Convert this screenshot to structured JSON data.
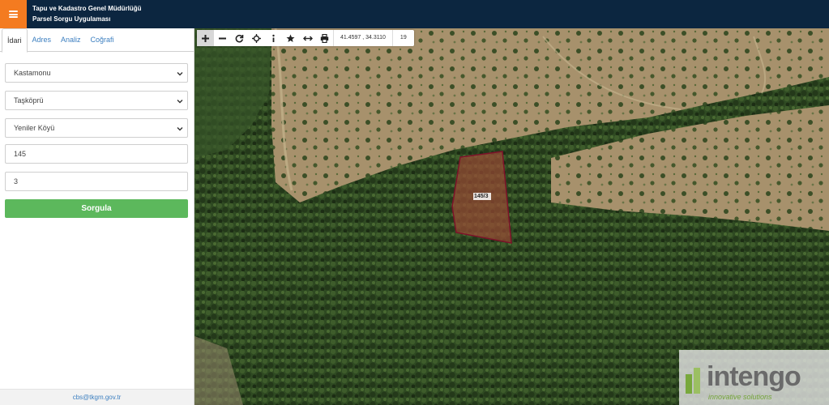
{
  "header": {
    "title_line1": "Tapu ve Kadastro Genel Müdürlüğü",
    "title_line2": "Parsel Sorgu Uygulaması",
    "menu_icon": "hamburger-icon",
    "accent_color": "#f47b20",
    "bar_color": "#0c2640"
  },
  "sidebar": {
    "tabs": [
      {
        "label": "İdari",
        "active": true
      },
      {
        "label": "Adres",
        "active": false
      },
      {
        "label": "Analiz",
        "active": false
      },
      {
        "label": "Coğrafi",
        "active": false
      }
    ],
    "province": {
      "value": "Kastamonu"
    },
    "district": {
      "value": "Taşköprü"
    },
    "neighborhood": {
      "value": "Yeniler Köyü"
    },
    "block": {
      "value": "145"
    },
    "parcel": {
      "value": "3"
    },
    "query_button": {
      "label": "Sorgula",
      "color": "#5cb85c"
    },
    "footer_email": "cbs@tkgm.gov.tr"
  },
  "map": {
    "toolbar": {
      "tools": [
        "zoom-in-icon",
        "zoom-out-icon",
        "refresh-icon",
        "locate-icon",
        "info-icon",
        "star-icon",
        "measure-icon",
        "print-icon"
      ],
      "coordinates": "41.4597 , 34.3110",
      "zoom_level": "19"
    },
    "parcel_label": "145/3",
    "parcel_outline_color": "#8b1a2b",
    "logo": {
      "word": "intengo",
      "tagline": "innovative solutions"
    }
  }
}
